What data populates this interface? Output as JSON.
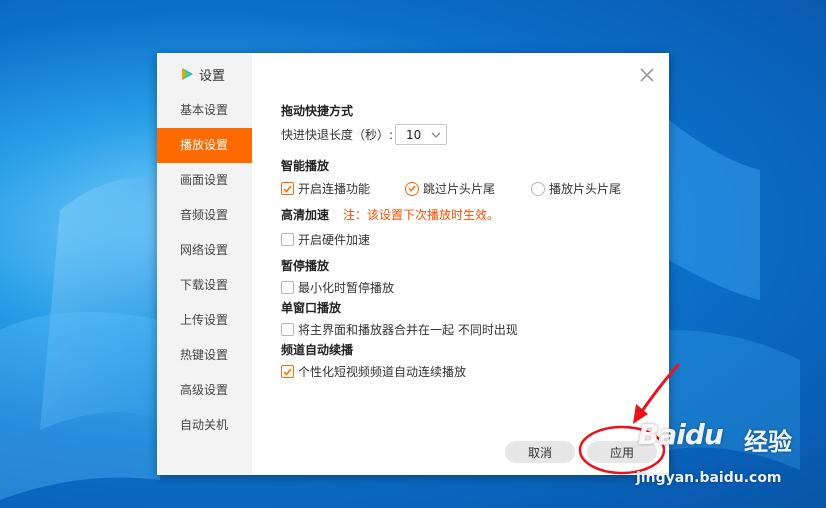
{
  "dialog": {
    "title": "设置",
    "close_icon": "close-icon",
    "brand_icon": "tencent-video-icon"
  },
  "sidebar": {
    "items": [
      {
        "label": "基本设置",
        "active": false
      },
      {
        "label": "播放设置",
        "active": true
      },
      {
        "label": "画面设置",
        "active": false
      },
      {
        "label": "音频设置",
        "active": false
      },
      {
        "label": "网络设置",
        "active": false
      },
      {
        "label": "下载设置",
        "active": false
      },
      {
        "label": "上传设置",
        "active": false
      },
      {
        "label": "热键设置",
        "active": false
      },
      {
        "label": "高级设置",
        "active": false
      },
      {
        "label": "自动关机",
        "active": false
      }
    ]
  },
  "sections": {
    "drag": {
      "title": "拖动快捷方式",
      "step_label": "快进快退长度（秒）:",
      "step_value": "10"
    },
    "smart": {
      "title": "智能播放",
      "continuous_label": "开启连播功能",
      "continuous_checked": true,
      "skip_label": "跳过片头片尾",
      "skip_selected": true,
      "play_label": "播放片头片尾",
      "play_selected": false
    },
    "hd": {
      "title": "高清加速",
      "note": "注：该设置下次播放时生效。",
      "hw_label": "开启硬件加速",
      "hw_checked": false
    },
    "pause": {
      "title": "暂停播放",
      "minimize_label": "最小化时暂停播放",
      "minimize_checked": false
    },
    "single": {
      "title": "单窗口播放",
      "merge_label": "将主界面和播放器合并在一起 不同时出现",
      "merge_checked": false
    },
    "channel": {
      "title": "频道自动续播",
      "auto_label": "个性化短视频频道自动连续播放",
      "auto_checked": true
    }
  },
  "footer": {
    "cancel_label": "取消",
    "apply_label": "应用"
  },
  "watermark": {
    "brand": "Baidu",
    "cn": "经验",
    "url": "jingyan.baidu.com"
  },
  "colors": {
    "accent": "#ff6a00",
    "annotation": "#e8141c",
    "note": "#ff4f00"
  }
}
